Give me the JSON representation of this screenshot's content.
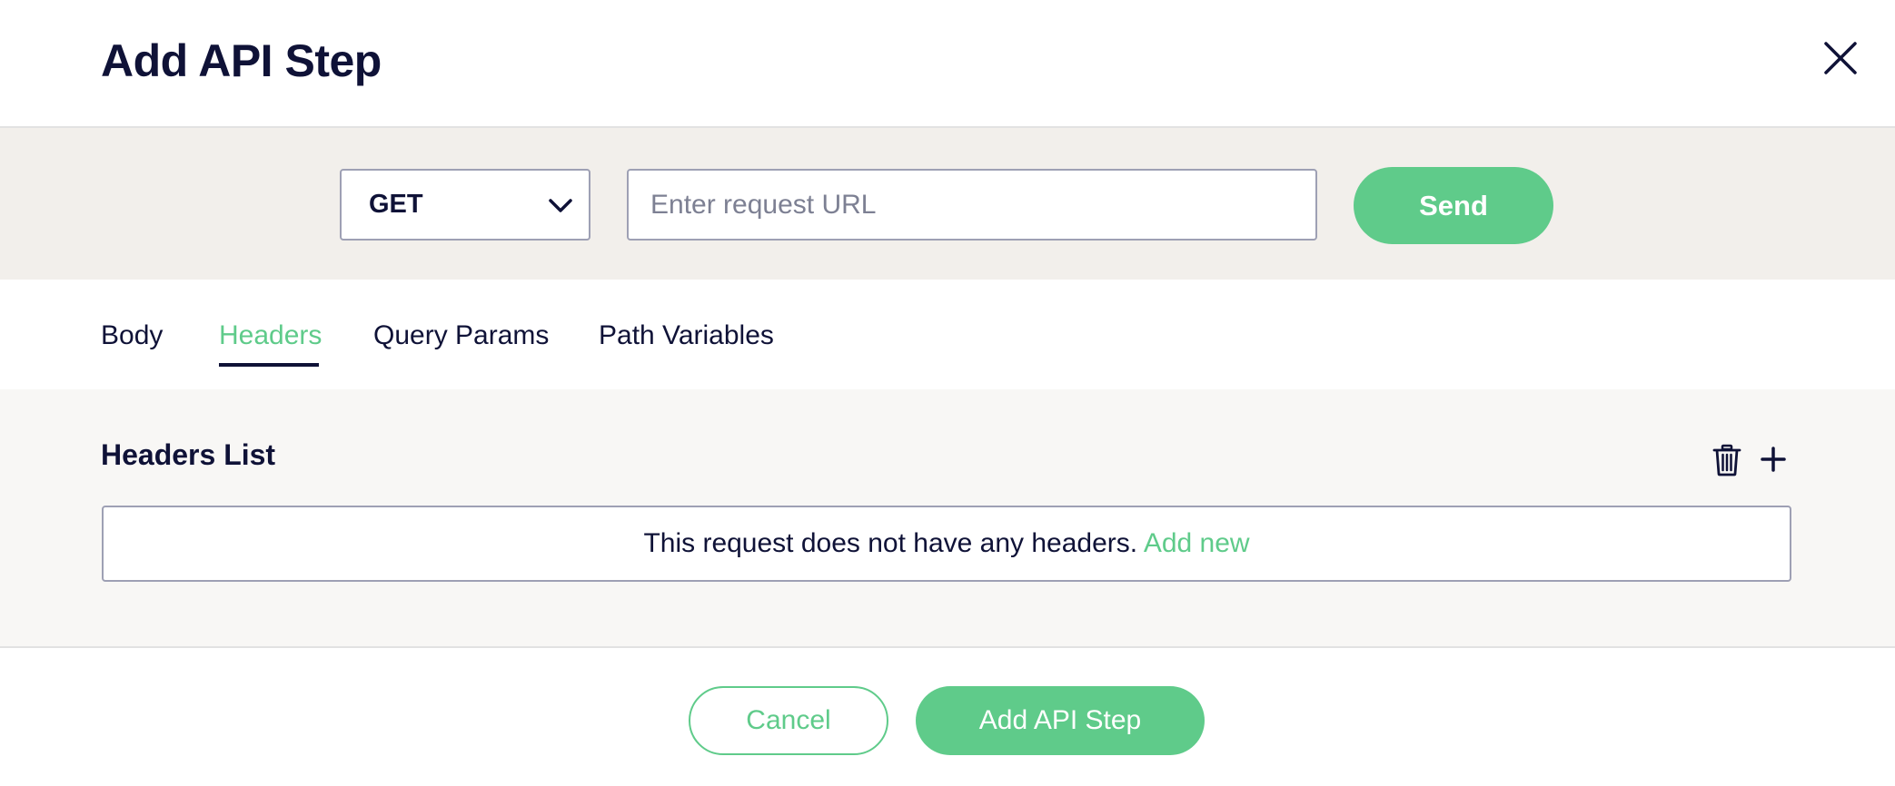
{
  "dialog": {
    "title": "Add API Step",
    "close_icon": "close-icon"
  },
  "request": {
    "method": "GET",
    "method_icon": "chevron-down-icon",
    "url_value": "",
    "url_placeholder": "Enter request URL",
    "send_label": "Send"
  },
  "tabs": [
    {
      "label": "Body",
      "active": false
    },
    {
      "label": "Headers",
      "active": true
    },
    {
      "label": "Query Params",
      "active": false
    },
    {
      "label": "Path Variables",
      "active": false
    }
  ],
  "headers_panel": {
    "title": "Headers List",
    "delete_icon": "trash-icon",
    "add_icon": "plus-icon",
    "empty_message": "This request does not have any headers.",
    "add_new_label": "Add new"
  },
  "footer": {
    "cancel_label": "Cancel",
    "submit_label": "Add API Step"
  },
  "colors": {
    "accent": "#5fcb8a",
    "text": "#0f1237",
    "request_bar_bg": "#f2efeb",
    "panel_bg": "#f8f7f5",
    "border": "#9ea0b4"
  }
}
